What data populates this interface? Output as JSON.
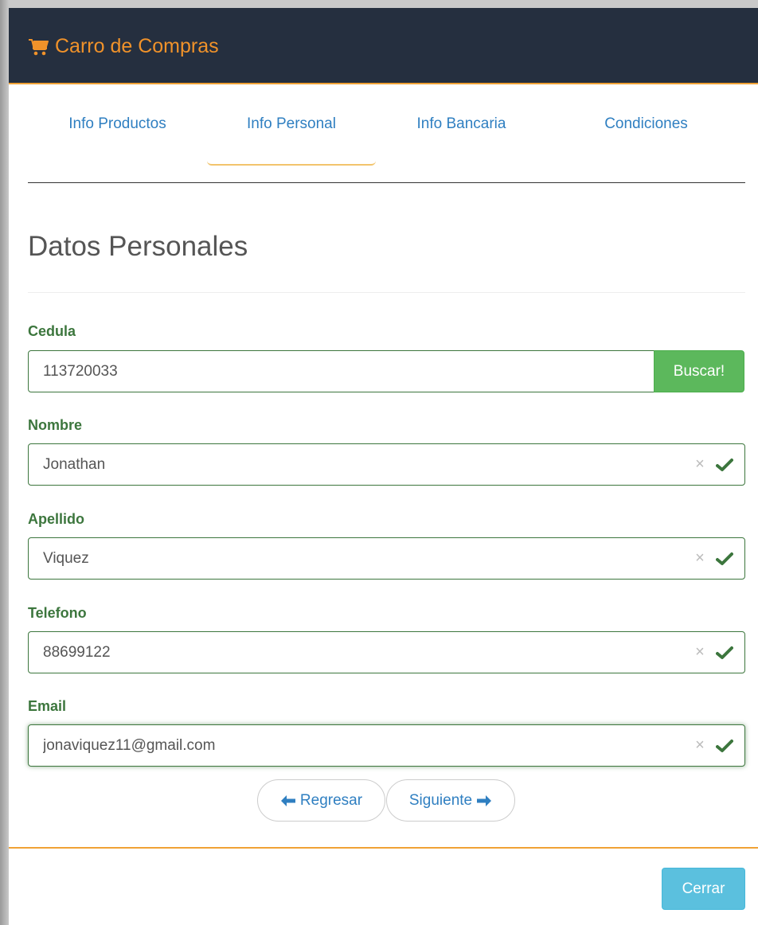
{
  "header": {
    "title": "Carro de Compras",
    "icon": "shopping-cart-icon",
    "accent": "#f0922a",
    "background": "#252f3f"
  },
  "tabs": [
    {
      "label": "Info Productos",
      "active": false
    },
    {
      "label": "Info Personal",
      "active": true
    },
    {
      "label": "Info Bancaria",
      "active": false
    },
    {
      "label": "Condiciones",
      "active": false
    }
  ],
  "section": {
    "title": "Datos Personales"
  },
  "form": {
    "cedula": {
      "label": "Cedula",
      "value": "113720033",
      "button": "Buscar!"
    },
    "nombre": {
      "label": "Nombre",
      "value": "Jonathan",
      "valid": true
    },
    "apellido": {
      "label": "Apellido",
      "value": "Viquez",
      "valid": true
    },
    "telefono": {
      "label": "Telefono",
      "value": "88699122",
      "valid": true
    },
    "email": {
      "label": "Email",
      "value": "jonaviquez11@gmail.com",
      "valid": true,
      "focused": true
    }
  },
  "nav": {
    "back": "Regresar",
    "next": "Siguiente"
  },
  "footer": {
    "close": "Cerrar"
  },
  "colors": {
    "valid": "#3c763d",
    "link": "#2f7fc1",
    "success": "#5cb85c",
    "info": "#5bc0de",
    "orange": "#f0a236"
  }
}
